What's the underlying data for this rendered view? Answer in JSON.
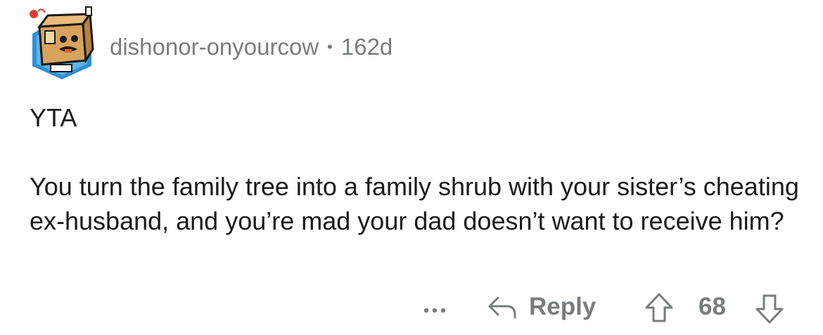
{
  "comment": {
    "author": "dishonor-onyourcow",
    "separator": "•",
    "age": "162d",
    "paragraphs": [
      "YTA",
      "You turn the family tree into a family shrub with your sister’s cheating ex-husband, and you’re mad your dad doesn’t want to receive him?"
    ]
  },
  "actions": {
    "more_label": "...",
    "reply_label": "Reply",
    "score": "68"
  },
  "icons": {
    "avatar": "cardboard-box-character-avatar-icon",
    "more": "more-options-icon",
    "reply": "reply-arrow-icon",
    "upvote": "upvote-arrow-icon",
    "downvote": "downvote-arrow-icon"
  },
  "colors": {
    "text": "#1a1a1b",
    "meta": "#787c7e",
    "avatar_bg": "#2f8fd8",
    "box": "#d9a35c"
  }
}
